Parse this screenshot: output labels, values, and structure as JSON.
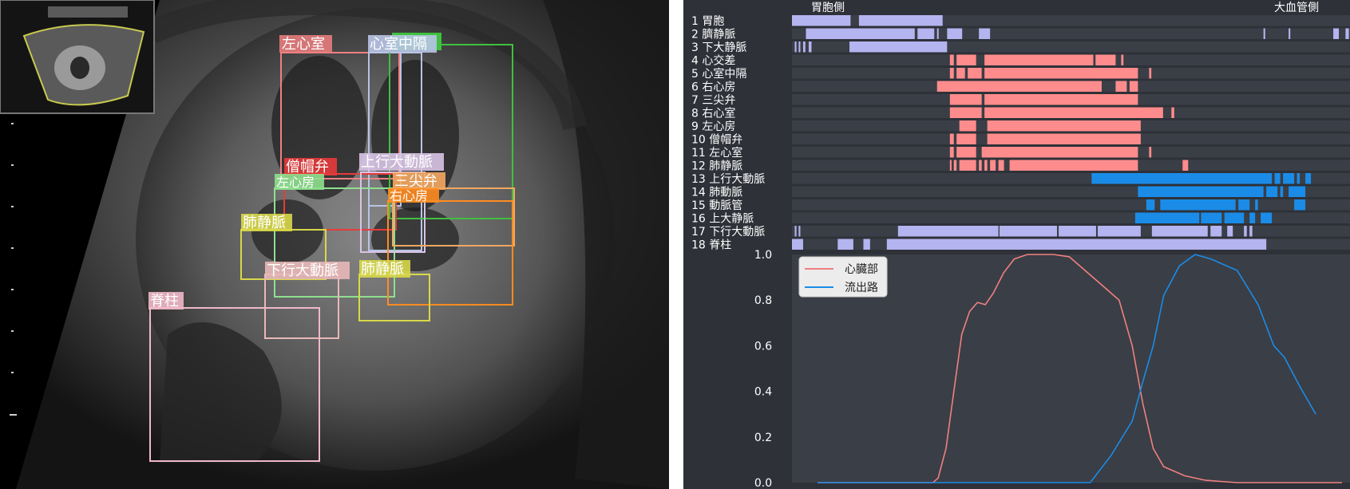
{
  "ultrasound": {
    "labels": {
      "lv": "左心室",
      "ivs": "心室中隔",
      "mv": "僧帽弁",
      "la": "左心房",
      "asc_aorta": "上行大動脈",
      "tv": "三尖弁",
      "ra": "右心房",
      "pv_left": "肺静脈",
      "desc_aorta": "下行大動脈",
      "pv_right": "肺静脈",
      "spine": "脊柱"
    },
    "colors": {
      "lv": "#f08080",
      "ivs": "#b8c4e6",
      "mv": "#e83a3a",
      "la": "#8ee08e",
      "asc_aorta": "#d8c4e6",
      "tv": "#f5a860",
      "ra": "#ff8c20",
      "pv": "#d8d84a",
      "desc_aorta": "#e8b8b8",
      "spine": "#f0b8c8",
      "extra_green": "#40c040"
    }
  },
  "analysis": {
    "side_left": "胃胞側",
    "side_right": "大血管側",
    "rows": [
      {
        "num": "1",
        "name": "胃胞"
      },
      {
        "num": "2",
        "name": "臍静脈"
      },
      {
        "num": "3",
        "name": "下大静脈"
      },
      {
        "num": "4",
        "name": "心交差"
      },
      {
        "num": "5",
        "name": "心室中隔"
      },
      {
        "num": "6",
        "name": "右心房"
      },
      {
        "num": "7",
        "name": "三尖弁"
      },
      {
        "num": "8",
        "name": "右心室"
      },
      {
        "num": "9",
        "name": "左心房"
      },
      {
        "num": "10",
        "name": "僧帽弁"
      },
      {
        "num": "11",
        "name": "左心室"
      },
      {
        "num": "12",
        "name": "肺静脈"
      },
      {
        "num": "13",
        "name": "上行大動脈"
      },
      {
        "num": "14",
        "name": "肺動脈"
      },
      {
        "num": "15",
        "name": "動脈管"
      },
      {
        "num": "16",
        "name": "上大静脈"
      },
      {
        "num": "17",
        "name": "下行大動脈"
      },
      {
        "num": "18",
        "name": "脊柱"
      }
    ],
    "colors": {
      "purple": "#b4b4f0",
      "pink": "#ff8c8c",
      "blue": "#1a8ce8",
      "bg": "#2e3138",
      "row_bg": "#3a3e46"
    },
    "chart_data": {
      "type": "line",
      "y_ticks": [
        "1.0",
        "0.8",
        "0.6",
        "0.4",
        "0.2",
        "0.0"
      ],
      "ylim": [
        0,
        1
      ],
      "series": [
        {
          "name": "心臓部",
          "color": "#f08080",
          "values": [
            [
              0,
              0
            ],
            [
              0.22,
              0
            ],
            [
              0.23,
              0.02
            ],
            [
              0.245,
              0.15
            ],
            [
              0.26,
              0.4
            ],
            [
              0.275,
              0.65
            ],
            [
              0.29,
              0.75
            ],
            [
              0.305,
              0.79
            ],
            [
              0.32,
              0.78
            ],
            [
              0.335,
              0.83
            ],
            [
              0.355,
              0.92
            ],
            [
              0.375,
              0.98
            ],
            [
              0.4,
              1.0
            ],
            [
              0.45,
              1.0
            ],
            [
              0.48,
              0.99
            ],
            [
              0.51,
              0.93
            ],
            [
              0.55,
              0.85
            ],
            [
              0.575,
              0.8
            ],
            [
              0.6,
              0.6
            ],
            [
              0.62,
              0.35
            ],
            [
              0.64,
              0.15
            ],
            [
              0.66,
              0.07
            ],
            [
              0.7,
              0.03
            ],
            [
              0.74,
              0.01
            ],
            [
              0.8,
              0.0
            ],
            [
              1.0,
              0.0
            ]
          ]
        },
        {
          "name": "流出路",
          "color": "#1a8ce8",
          "values": [
            [
              0,
              0
            ],
            [
              0.52,
              0
            ],
            [
              0.56,
              0.12
            ],
            [
              0.6,
              0.27
            ],
            [
              0.62,
              0.44
            ],
            [
              0.64,
              0.6
            ],
            [
              0.66,
              0.82
            ],
            [
              0.69,
              0.95
            ],
            [
              0.72,
              1.0
            ],
            [
              0.75,
              0.98
            ],
            [
              0.8,
              0.93
            ],
            [
              0.84,
              0.78
            ],
            [
              0.87,
              0.6
            ],
            [
              0.89,
              0.55
            ],
            [
              0.92,
              0.42
            ],
            [
              0.95,
              0.3
            ]
          ]
        }
      ]
    }
  }
}
